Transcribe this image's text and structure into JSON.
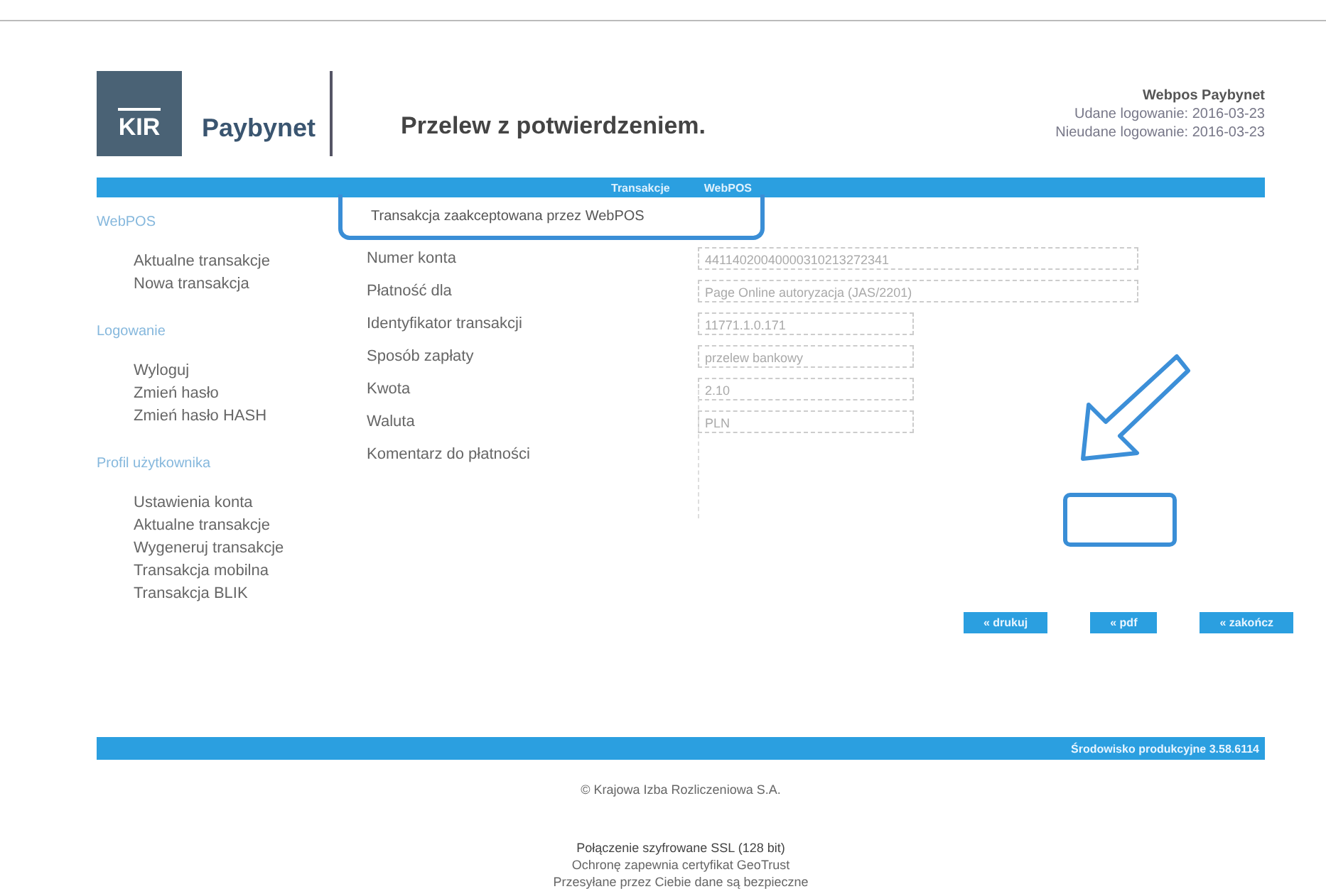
{
  "header": {
    "logo_mark": "KIR",
    "logo_text": "Paybynet",
    "title": "Przelew z potwierdzeniem.",
    "user": "Webpos Paybynet",
    "last_login": "Udane logowanie: 2016-03-23",
    "failed_login": "Nieudane logowanie: 2016-03-23"
  },
  "nav_bar": {
    "items": [
      "Transakcje",
      "WebPOS"
    ]
  },
  "sidebar": [
    {
      "heading": "WebPOS",
      "items": [
        "Aktualne transakcje",
        "Nowa transakcja"
      ]
    },
    {
      "heading": "Logowanie",
      "items": [
        "Wyloguj",
        "Zmień hasło",
        "Zmień hasło HASH"
      ]
    },
    {
      "heading": "Profil użytkownika",
      "items": [
        "Ustawienia konta",
        "Aktualne transakcje",
        "Wygeneruj transakcje",
        "Transakcja mobilna",
        "Transakcja BLIK"
      ]
    }
  ],
  "status_message": "Transakcja zaakceptowana przez WebPOS",
  "form": [
    {
      "label": "Numer konta",
      "value": "44114020040000310213272341",
      "wide": true
    },
    {
      "label": "Płatność dla",
      "value": "Page Online autoryzacja (JAS/2201)",
      "wide": true
    },
    {
      "label": "Identyfikator transakcji",
      "value": "11771.1.0.171",
      "wide": false
    },
    {
      "label": "Sposób zapłaty",
      "value": "przelew bankowy",
      "wide": false
    },
    {
      "label": "Kwota",
      "value": "2.10",
      "wide": false
    },
    {
      "label": "Waluta",
      "value": "PLN",
      "wide": false
    },
    {
      "label": "Komentarz do płatności",
      "kind": "textarea"
    }
  ],
  "buttons": [
    "« drukuj",
    "« pdf",
    "« zakończ"
  ],
  "footer_bar": "Środowisko produkcyjne 3.58.6114",
  "copyright": "© Krajowa Izba Rozliczeniowa S.A.",
  "security": [
    "Połączenie szyfrowane SSL (128 bit)",
    "Ochronę zapewnia certyfikat GeoTrust",
    "Przesyłane przez Ciebie dane są bezpieczne"
  ]
}
